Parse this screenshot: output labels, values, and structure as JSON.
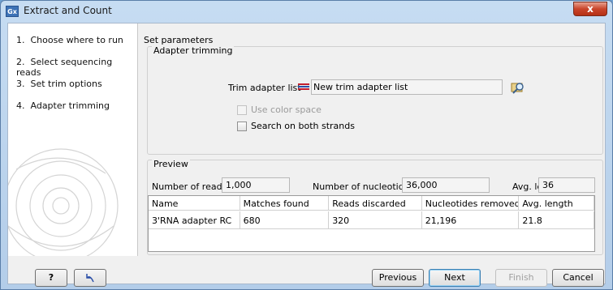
{
  "window": {
    "app_icon": "Gx",
    "title": "Extract and Count",
    "close_glyph": "x"
  },
  "steps": [
    {
      "number": "1.",
      "label": "Choose where to run"
    },
    {
      "number": "2.",
      "label": "Select sequencing reads"
    },
    {
      "number": "3.",
      "label": "Set trim options"
    },
    {
      "number": "4.",
      "label": "Adapter trimming"
    }
  ],
  "main": {
    "section_title": "Set parameters",
    "adapter_group": {
      "label": "Adapter trimming",
      "trim_list_label": "Trim adapter list",
      "trim_list_value": "New trim adapter list",
      "use_color_space_label": "Use color space",
      "use_color_space_checked": false,
      "use_color_space_enabled": false,
      "search_both_strands_label": "Search on both strands",
      "search_both_strands_checked": false
    },
    "preview": {
      "label": "Preview",
      "num_reads_label": "Number of reads",
      "num_reads_value": "1,000",
      "num_nucleotides_label": "Number of nucleotides",
      "num_nucleotides_value": "36,000",
      "avg_length_label": "Avg. length",
      "avg_length_value": "36",
      "table": {
        "columns": [
          "Name",
          "Matches found",
          "Reads discarded",
          "Nucleotides removed",
          "Avg. length"
        ],
        "rows": [
          [
            "3'RNA adapter RC",
            "680",
            "320",
            "21,196",
            "21.8"
          ]
        ]
      }
    }
  },
  "footer": {
    "help_label": "?",
    "reset_icon": "reset-icon",
    "previous_label": "Previous",
    "next_label": "Next",
    "finish_label": "Finish",
    "cancel_label": "Cancel"
  },
  "colors": {
    "title_bar": "#c6dcf2",
    "close_button": "#c9452b",
    "list_icon_red": "#c21e2e",
    "list_icon_blue": "#2b4fa8"
  }
}
